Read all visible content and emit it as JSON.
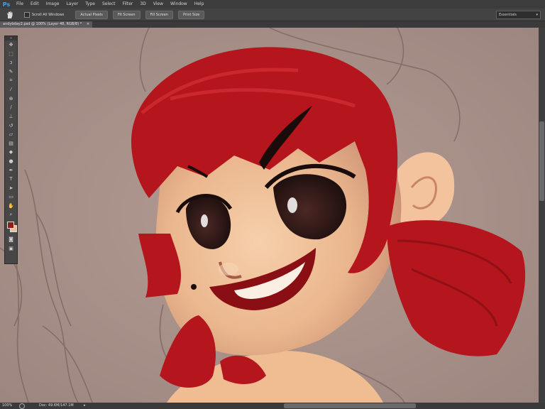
{
  "app": {
    "logo": "Ps"
  },
  "menu": [
    "File",
    "Edit",
    "Image",
    "Layer",
    "Type",
    "Select",
    "Filter",
    "3D",
    "View",
    "Window",
    "Help"
  ],
  "options_bar": {
    "scroll_all_windows": "Scroll All Windows",
    "buttons": [
      "Actual Pixels",
      "Fit Screen",
      "Fill Screen",
      "Print Size"
    ],
    "workspace": "Essentials"
  },
  "document_tab": "andybday2.psd @ 100% (Layer 48, RGB/8) *",
  "status_bar": {
    "zoom": "100%",
    "doc": "Doc: 49.6M/147.1M"
  },
  "colors": {
    "canvas_bg": "#a58f88",
    "skin": "#f0bd92",
    "hair": "#b5151c",
    "foreground_swatch": "#8a2116",
    "background_swatch": "#f0bd92"
  },
  "tools": [
    "move-tool",
    "marquee-tool",
    "lasso-tool",
    "quick-selection-tool",
    "crop-tool",
    "eyedropper-tool",
    "spot-healing-tool",
    "brush-tool",
    "clone-stamp-tool",
    "history-brush-tool",
    "eraser-tool",
    "gradient-tool",
    "blur-tool",
    "dodge-tool",
    "pen-tool",
    "type-tool",
    "path-selection-tool",
    "shape-tool",
    "hand-tool",
    "zoom-tool"
  ]
}
